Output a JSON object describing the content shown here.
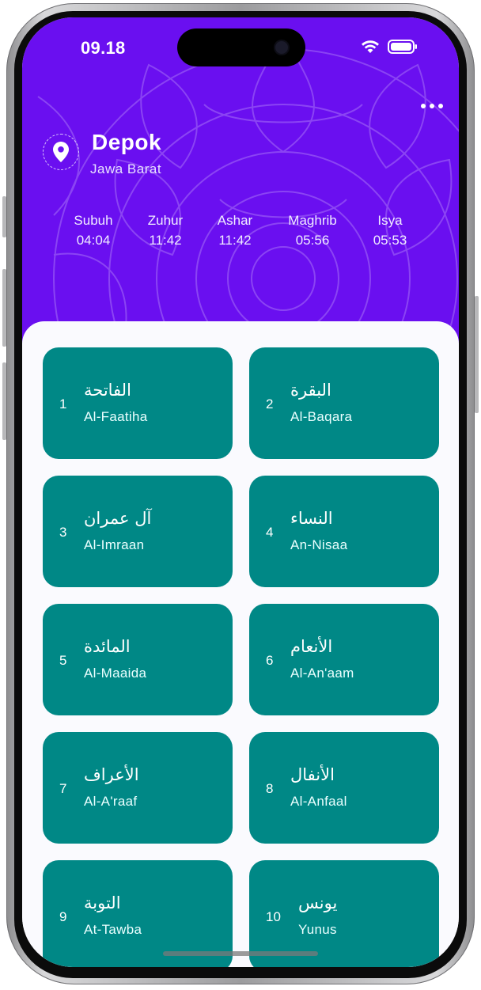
{
  "status_bar": {
    "time": "09.18",
    "wifi_icon": "wifi-icon",
    "battery_icon": "battery-icon"
  },
  "header": {
    "city": "Depok",
    "region": "Jawa Barat",
    "location_icon": "location-pin-icon",
    "menu_icon": "more-horizontal-icon",
    "accent_color": "#6a0ff0"
  },
  "prayer_times": [
    {
      "name": "Subuh",
      "time": "04:04"
    },
    {
      "name": "Zuhur",
      "time": "11:42"
    },
    {
      "name": "Ashar",
      "time": "11:42"
    },
    {
      "name": "Maghrib",
      "time": "05:56"
    },
    {
      "name": "Isya",
      "time": "05:53"
    }
  ],
  "surahs": [
    {
      "number": "1",
      "arabic": "الفاتحة",
      "latin": "Al-Faatiha"
    },
    {
      "number": "2",
      "arabic": "البقرة",
      "latin": "Al-Baqara"
    },
    {
      "number": "3",
      "arabic": "آل عمران",
      "latin": "Al-Imraan"
    },
    {
      "number": "4",
      "arabic": "النساء",
      "latin": "An-Nisaa"
    },
    {
      "number": "5",
      "arabic": "المائدة",
      "latin": "Al-Maaida"
    },
    {
      "number": "6",
      "arabic": "الأنعام",
      "latin": "Al-An'aam"
    },
    {
      "number": "7",
      "arabic": "الأعراف",
      "latin": "Al-A'raaf"
    },
    {
      "number": "8",
      "arabic": "الأنفال",
      "latin": "Al-Anfaal"
    },
    {
      "number": "9",
      "arabic": "التوبة",
      "latin": "At-Tawba"
    },
    {
      "number": "10",
      "arabic": "يونس",
      "latin": "Yunus"
    }
  ],
  "card_color": "#008886"
}
